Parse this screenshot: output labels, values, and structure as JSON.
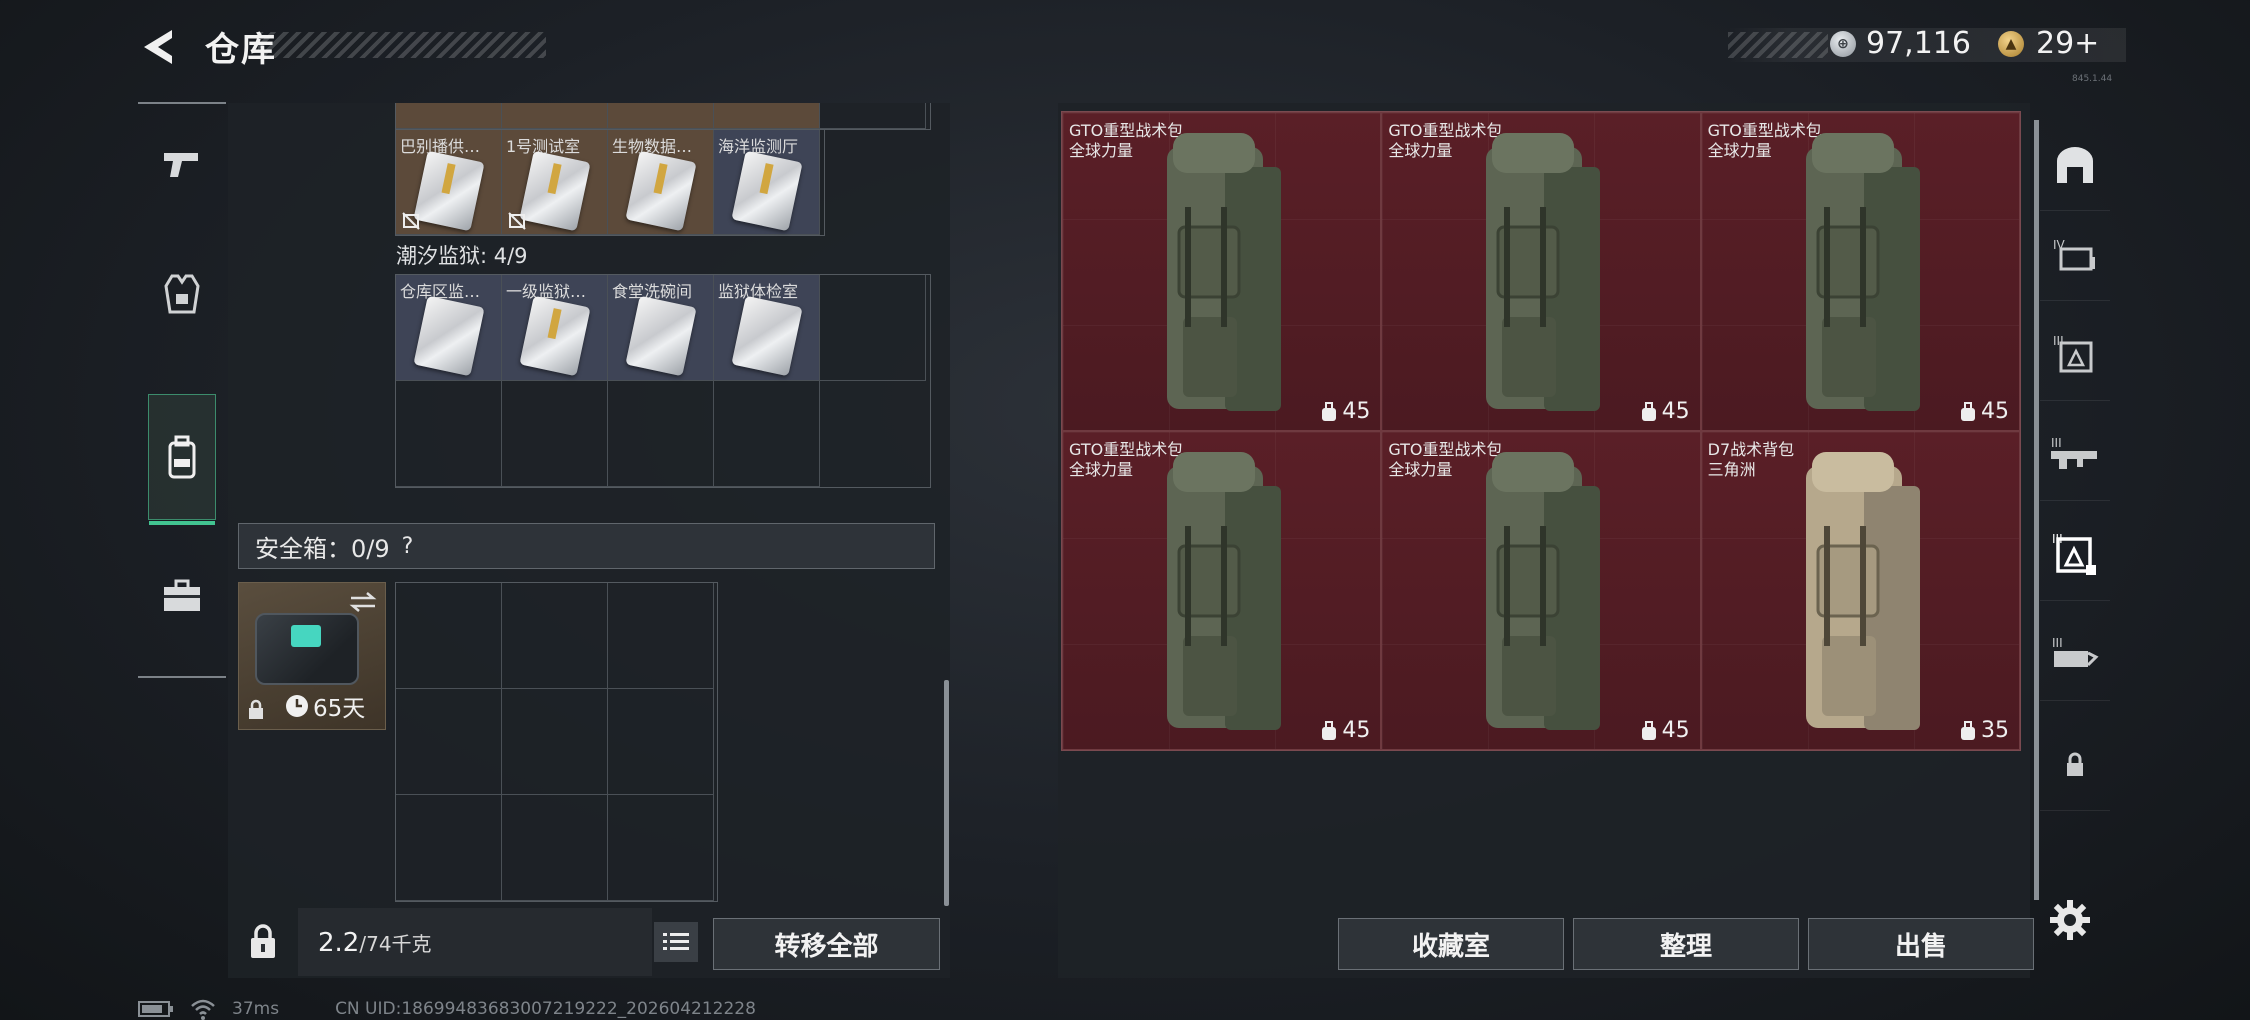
{
  "header": {
    "title": "仓库",
    "currency_silver": "97,116",
    "currency_gold": "29+",
    "version": "845.1.44"
  },
  "left_nav": [
    {
      "name": "weapons",
      "icon": "pistol-icon"
    },
    {
      "name": "armor",
      "icon": "vest-icon"
    },
    {
      "name": "backpack",
      "icon": "backpack-icon",
      "active": true
    },
    {
      "name": "toolbox",
      "icon": "briefcase-icon"
    }
  ],
  "key_cards": {
    "top_row": [
      "巴别播供…",
      "1号测试室",
      "生物数据…",
      "海洋监测厅"
    ],
    "prison_label": "潮汐监狱: 4/9",
    "prison_row": [
      "仓库区监…",
      "一级监狱…",
      "食堂洗碗间",
      "监狱体检室"
    ]
  },
  "safebox": {
    "label": "安全箱：0/9",
    "help": "?",
    "days": "65天"
  },
  "footer_left": {
    "weight_value": "2.2",
    "weight_max": "/74千克",
    "transfer_all": "转移全部"
  },
  "backpacks": [
    {
      "name": "GTO重型战术包",
      "brand": "全球力量",
      "capacity": "45",
      "variant": "green"
    },
    {
      "name": "GTO重型战术包",
      "brand": "全球力量",
      "capacity": "45",
      "variant": "green"
    },
    {
      "name": "GTO重型战术包",
      "brand": "全球力量",
      "capacity": "45",
      "variant": "green"
    },
    {
      "name": "GTO重型战术包",
      "brand": "全球力量",
      "capacity": "45",
      "variant": "green"
    },
    {
      "name": "GTO重型战术包",
      "brand": "全球力量",
      "capacity": "45",
      "variant": "green"
    },
    {
      "name": "D7战术背包",
      "brand": "三角洲",
      "capacity": "35",
      "variant": "tan"
    }
  ],
  "footer_right": {
    "collection": "收藏室",
    "sort": "整理",
    "sell": "出售"
  },
  "right_nav": [
    {
      "name": "armory-icon"
    },
    {
      "name": "tier-iv-weapon-icon",
      "tier": "IV"
    },
    {
      "name": "tier-iii-armor-icon",
      "tier": "III"
    },
    {
      "name": "tier-iii-rifle-icon",
      "tier": "III"
    },
    {
      "name": "tier-iii-bag-icon",
      "tier": "III",
      "active": true
    },
    {
      "name": "tier-iii-helmet-icon",
      "tier": "III"
    },
    {
      "name": "lock-icon"
    }
  ],
  "status": {
    "ping": "37ms",
    "uid": "CN UID:18699483683007219222_202604212228"
  },
  "colors": {
    "accent_green": "#42c491",
    "bag_cell_bg": "#52202a",
    "card_gold_bg": "#5c4a3a",
    "card_blue_bg": "#3e4456"
  }
}
